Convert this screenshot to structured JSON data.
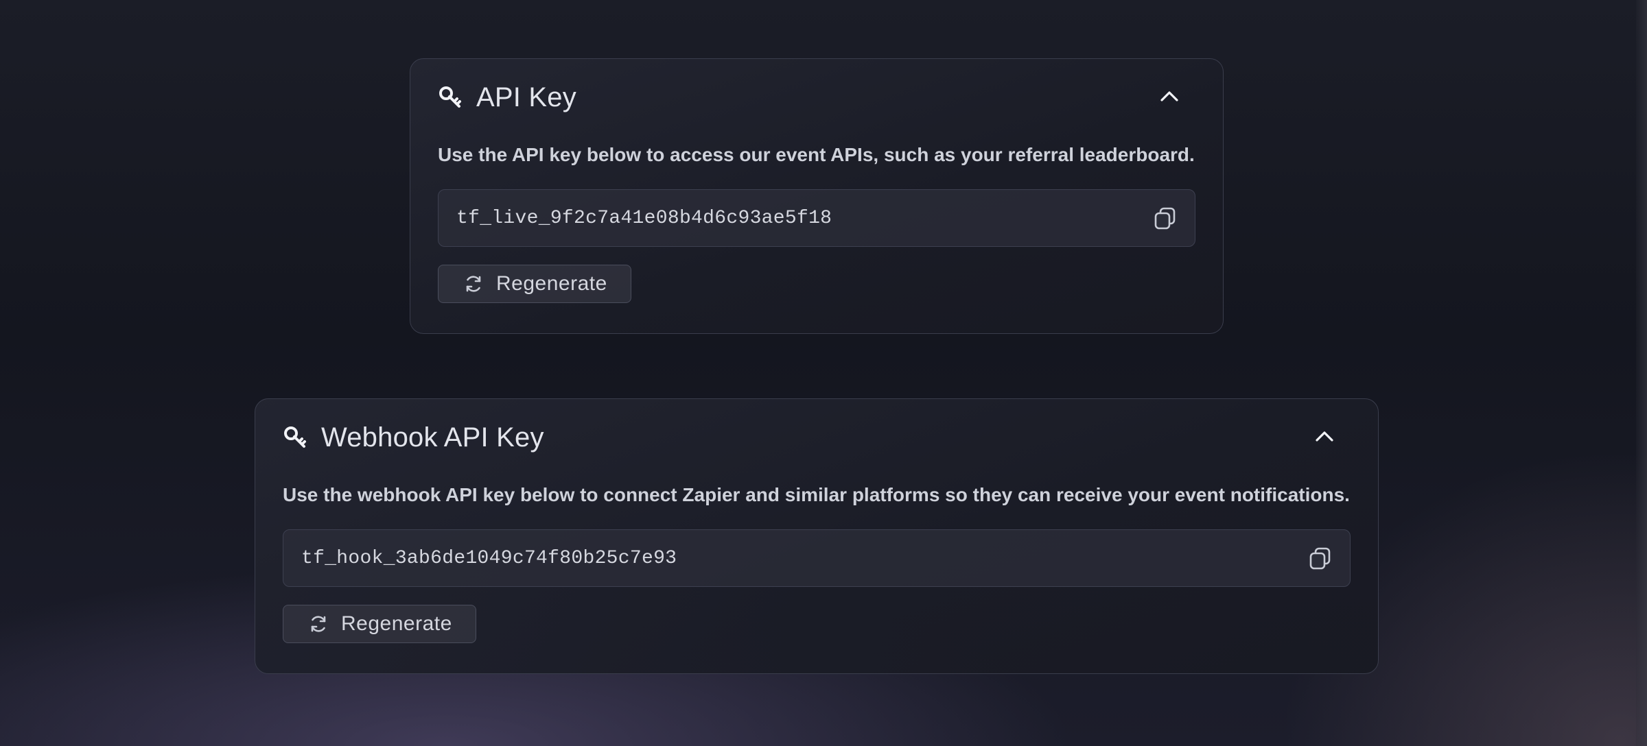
{
  "api_key_card": {
    "title": "API Key",
    "description": "Use the API key below to access our event APIs, such as your referral leaderboard.",
    "key_value": "tf_live_9f2c7a41e08b4d6c93ae5f18",
    "regenerate_label": "Regenerate",
    "icons": {
      "header": "key-icon",
      "collapse": "chevron-up-icon",
      "copy": "copy-icon",
      "regenerate": "refresh-icon"
    }
  },
  "webhook_card": {
    "title": "Webhook API Key",
    "description": "Use the webhook API key below to connect Zapier and similar platforms so they can receive your event notifications.",
    "key_value": "tf_hook_3ab6de1049c74f80b25c7e93",
    "regenerate_label": "Regenerate",
    "icons": {
      "header": "key-icon",
      "collapse": "chevron-up-icon",
      "copy": "copy-icon",
      "regenerate": "refresh-icon"
    }
  },
  "colors": {
    "background": "#15171f",
    "card_border": "#3a3d4c",
    "text": "#d9dbe3",
    "field_background": "#2c2e3a"
  }
}
